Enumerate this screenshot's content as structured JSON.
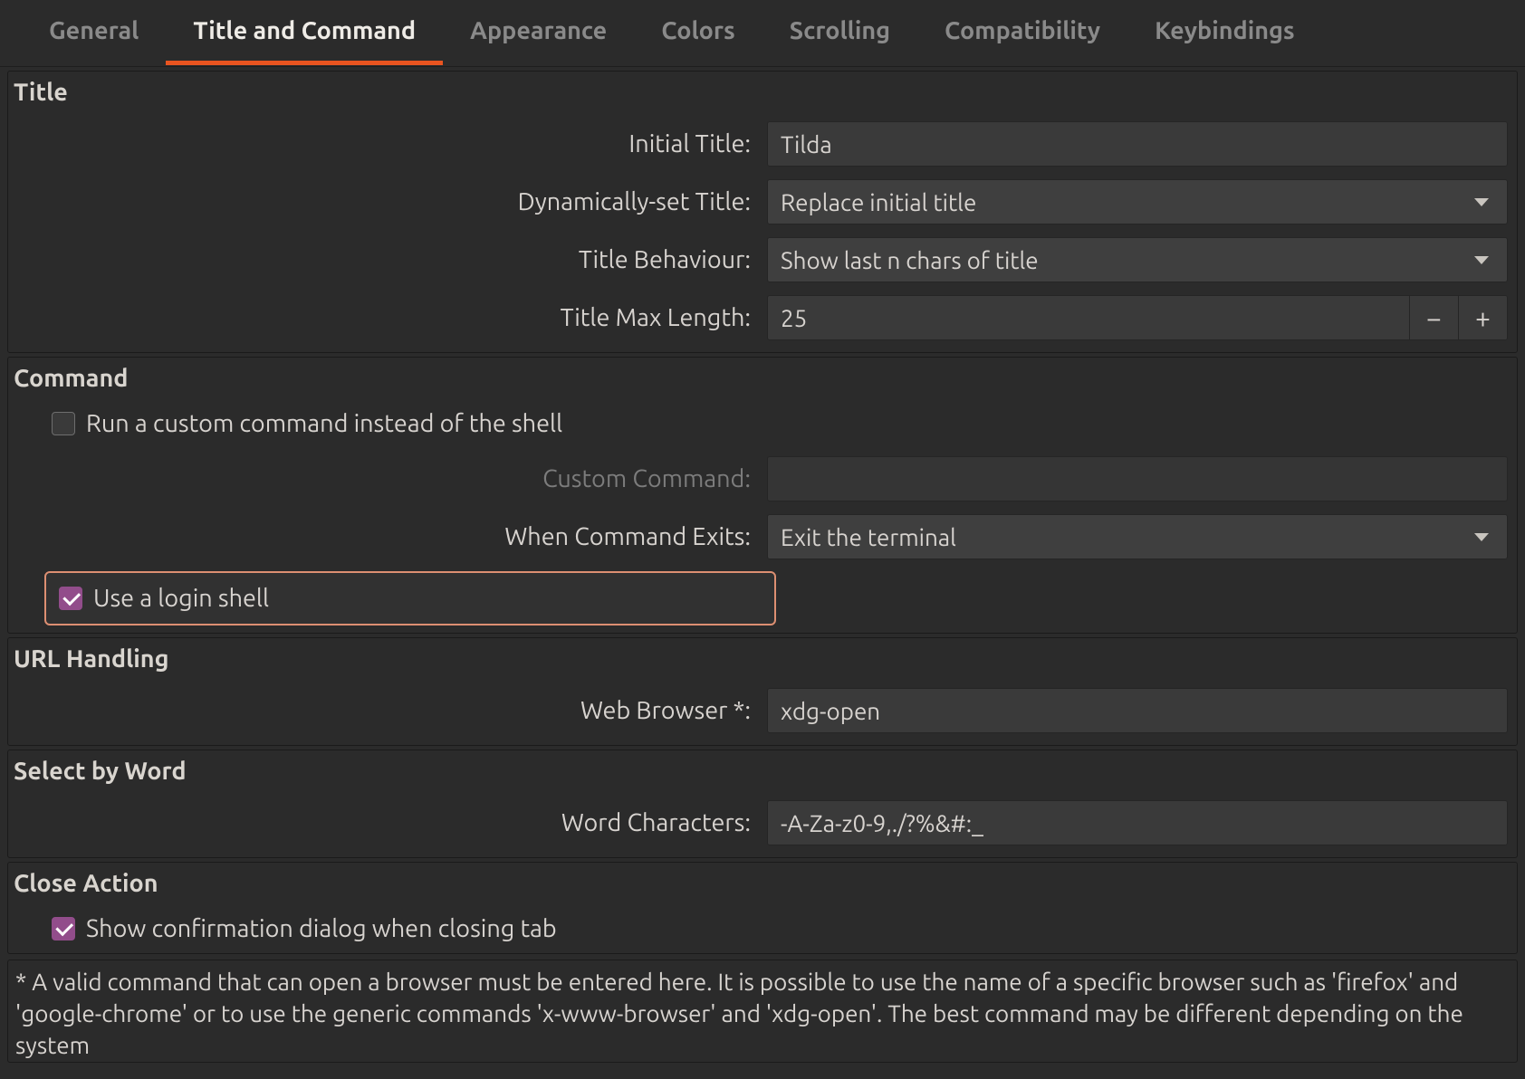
{
  "tabs": {
    "general": "General",
    "title_and_command": "Title and Command",
    "appearance": "Appearance",
    "colors": "Colors",
    "scrolling": "Scrolling",
    "compatibility": "Compatibility",
    "keybindings": "Keybindings"
  },
  "title_section": {
    "heading": "Title",
    "initial_title_label": "Initial Title:",
    "initial_title_value": "Tilda",
    "dyn_title_label": "Dynamically-set Title:",
    "dyn_title_value": "Replace initial title",
    "behaviour_label": "Title Behaviour:",
    "behaviour_value": "Show last n chars of title",
    "maxlen_label": "Title Max Length:",
    "maxlen_value": "25"
  },
  "command_section": {
    "heading": "Command",
    "custom_cmd_checkbox_label": "Run a custom command instead of the shell",
    "custom_cmd_label": "Custom Command:",
    "custom_cmd_value": "",
    "when_exit_label": "When Command Exits:",
    "when_exit_value": "Exit the terminal",
    "login_shell_label": "Use a login shell"
  },
  "url_section": {
    "heading": "URL Handling",
    "browser_label": "Web Browser *:",
    "browser_value": "xdg-open"
  },
  "word_section": {
    "heading": "Select by Word",
    "chars_label": "Word Characters:",
    "chars_value": "-A-Za-z0-9,./?%&#:_"
  },
  "close_section": {
    "heading": "Close Action",
    "confirm_label": "Show confirmation dialog when closing tab"
  },
  "footnote": "* A valid command that can open a browser must be entered here. It is possible to use the name of a specific browser such as 'firefox' and 'google-chrome' or to use the generic commands 'x-www-browser' and 'xdg-open'. The best command may be different depending on the system"
}
